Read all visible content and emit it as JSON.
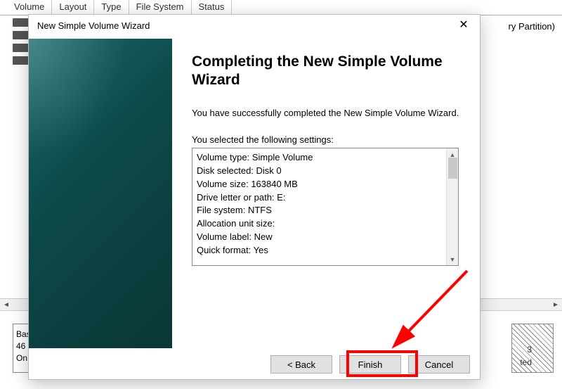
{
  "background": {
    "headers": [
      "Volume",
      "Layout",
      "Type",
      "File System",
      "Status"
    ],
    "right_text": "ry Partition)",
    "disk_label1": "Bas",
    "disk_label2": "46",
    "disk_label3": "On",
    "crumb1": "3",
    "crumb2": "ted"
  },
  "wizard": {
    "title": "New Simple Volume Wizard",
    "heading": "Completing the New Simple Volume Wizard",
    "success_text": "You have successfully completed the New Simple Volume Wizard.",
    "settings_label": "You selected the following settings:",
    "settings": [
      "Volume type: Simple Volume",
      "Disk selected: Disk 0",
      "Volume size: 163840 MB",
      "Drive letter or path: E:",
      "File system: NTFS",
      "Allocation unit size:",
      "Volume label: New",
      "Quick format: Yes"
    ],
    "buttons": {
      "back": "< Back",
      "finish": "Finish",
      "cancel": "Cancel"
    }
  }
}
